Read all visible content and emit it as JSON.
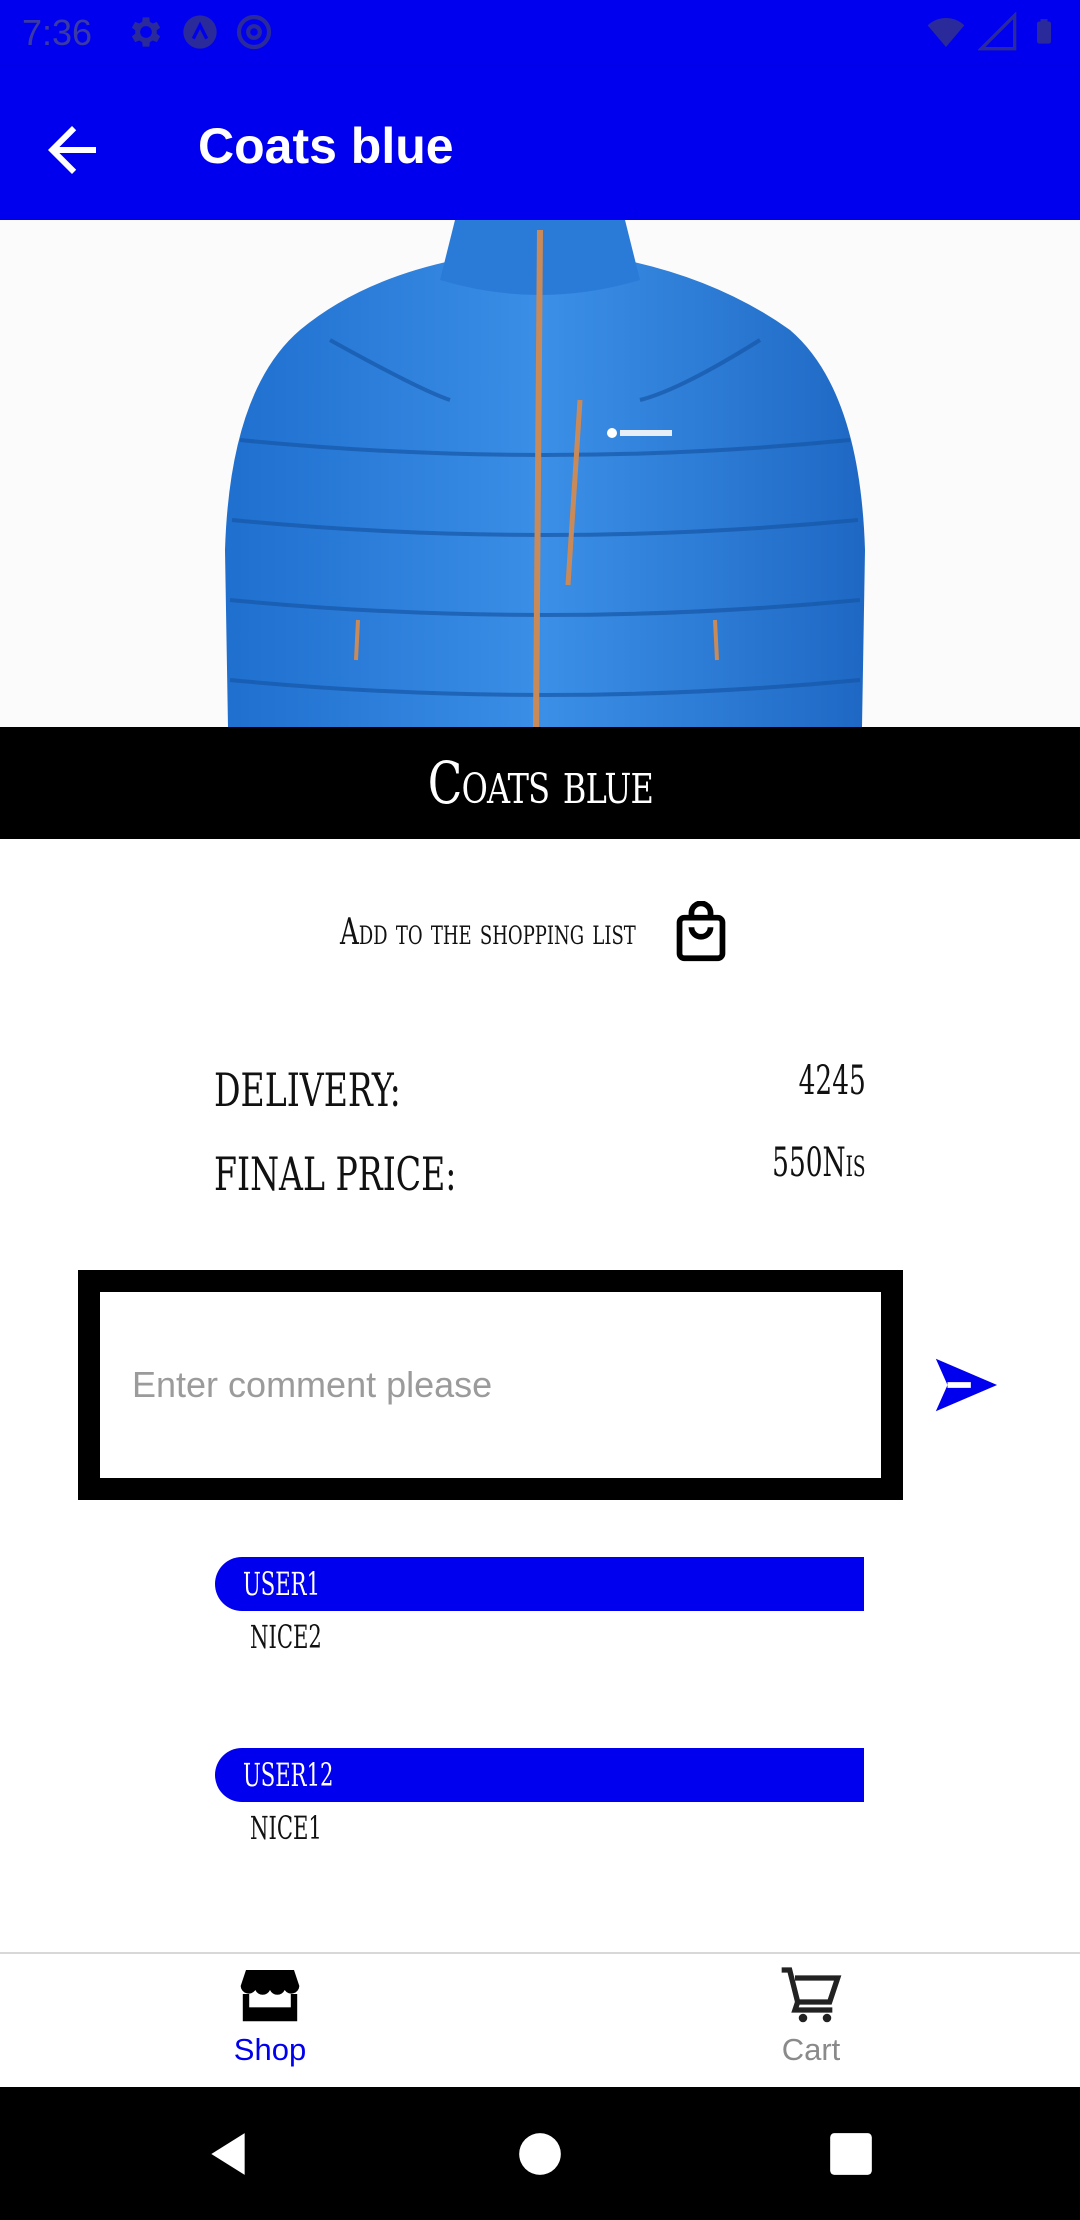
{
  "status_bar": {
    "time": "7:36"
  },
  "app_bar": {
    "title": "Coats blue",
    "back_icon": "arrow-left-icon"
  },
  "product": {
    "image_alt": "blue puffer jacket",
    "name": "Coats blue",
    "add_to_list_label": "Add to the shopping list",
    "bag_icon": "shopping-bag-icon"
  },
  "pricing": {
    "delivery_label": "Delivery:",
    "delivery_value": "4245",
    "final_price_label": "Final price:",
    "final_price_value": "550Nis"
  },
  "comment_box": {
    "placeholder": "Enter comment please",
    "value": ""
  },
  "comments": [
    {
      "user": "user1",
      "text": "nice2"
    },
    {
      "user": "user12",
      "text": "nice1"
    }
  ],
  "bottom_nav": {
    "items": [
      {
        "label": "Shop",
        "icon": "store-icon",
        "active": true
      },
      {
        "label": "Cart",
        "icon": "cart-icon",
        "active": false
      }
    ]
  },
  "colors": {
    "primary": "#0000ee",
    "banner": "#000000",
    "inactive": "#8a8a8a"
  }
}
